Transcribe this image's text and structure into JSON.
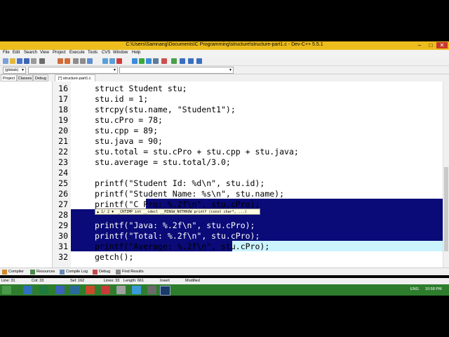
{
  "window": {
    "title": "C:\\Users\\Samnang\\Documents\\C Programming\\structure\\structure-part1.c - Dev-C++ 5.5.1",
    "minimize": "–",
    "maximize": "□",
    "close": "✕"
  },
  "menu": [
    "File",
    "Edit",
    "Search",
    "View",
    "Project",
    "Execute",
    "Tools",
    "CVS",
    "Window",
    "Help"
  ],
  "toolbar2": {
    "globals_combo": "(globals)",
    "combo2": "",
    "combo3": ""
  },
  "left_tabs": [
    "Project",
    "Classes",
    "Debug"
  ],
  "editor_tab": "[*] structure-part1.c",
  "code_lines": [
    {
      "n": "16",
      "t": "struct Student stu;"
    },
    {
      "n": "17",
      "t": "stu.id = 1;"
    },
    {
      "n": "18",
      "t": "strcpy(stu.name, \"Student1\");"
    },
    {
      "n": "19",
      "t": "stu.cPro = 78;"
    },
    {
      "n": "20",
      "t": "stu.cpp = 89;"
    },
    {
      "n": "21",
      "t": "stu.java = 90;"
    },
    {
      "n": "22",
      "t": "stu.total = stu.cPro + stu.cpp + stu.java;"
    },
    {
      "n": "23",
      "t": "stu.average = stu.total/3.0;"
    },
    {
      "n": "24",
      "t": ""
    },
    {
      "n": "25",
      "t": "printf(\"Student Id: %d\\n\", stu.id);"
    },
    {
      "n": "26",
      "t": "printf(\"Student Name: %s\\n\", stu.name);"
    },
    {
      "n": "27",
      "t": "printf(\"C Pro: %.2f\\n\", stu.cPro);"
    },
    {
      "n": "28",
      "t": ""
    },
    {
      "n": "29",
      "t": "printf(\"Java: %.2f\\n\", stu.cPro);"
    },
    {
      "n": "30",
      "t": "printf(\"Total: %.2f\\n\", stu.cPro);"
    },
    {
      "n": "31",
      "t": "printf(\"Average: %.2f\\n\", stu.cPro);"
    },
    {
      "n": "32",
      "t": "getch();"
    }
  ],
  "tooltip": "▲ 1/ 2 ▼  _CRTIMP int __cdecl __MINGW_NOTHROW printf (const char*, ...)",
  "bottom_tabs": [
    "Compiler",
    "Resources",
    "Compile Log",
    "Debug",
    "Find Results"
  ],
  "status": {
    "line": "Line:   31",
    "col": "Col:   33",
    "sel": "Sel:   162",
    "lines": "Lines:   33",
    "length": "Length:   661",
    "insert": "Insert",
    "modified": "Modified"
  },
  "taskbar": {
    "lang": "ENG",
    "time": "10:58 PM"
  },
  "colors": {
    "titlebar": "#ecbd1d",
    "selection": "#0a0a78",
    "string": "#0b0bb0",
    "taskbar": "#2d7d2d"
  }
}
